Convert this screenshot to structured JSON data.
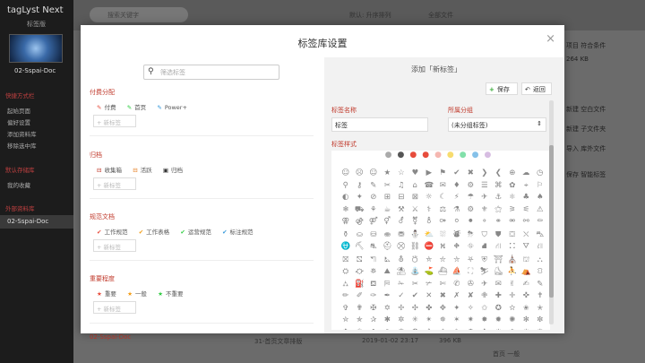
{
  "app": {
    "title": "tagLyst Next",
    "subtitle": "标签版",
    "library_name": "02-Sspai-Doc",
    "sections": [
      {
        "title": "快捷方式栏",
        "items": [
          "起始页面",
          "偏好设置",
          "添加资料库",
          "移除选中库"
        ]
      },
      {
        "title": "默认存储库",
        "items": [
          "我的收藏"
        ]
      },
      {
        "title": "外部资料库",
        "items": [
          "02-Sspai-Doc"
        ]
      }
    ],
    "search_placeholder": "搜索关键字",
    "sort_label": "默认: 升序排列",
    "filter_label": "全部文件",
    "right_info": [
      "项目 符合条件",
      "264 KB",
      "新建 空白文件",
      "新建 子文件夹",
      "导入 库外文件",
      "保存 智能标签"
    ],
    "bottom_row": {
      "name": "31-首页文章排版",
      "date": "2019-01-02 23:17",
      "size": "396 KB",
      "tags": "首页 一般"
    },
    "lib_bottom": "02-Sspai-Doc"
  },
  "dialog": {
    "title": "标签库设置",
    "close": "×",
    "filter_placeholder": "筛选标签",
    "groups": [
      {
        "name": "付费分配",
        "tags": [
          {
            "label": "付费",
            "color": "#e74c3c",
            "icon": "feather-icon"
          },
          {
            "label": "首页",
            "color": "#2ecc40",
            "icon": "feather-icon"
          },
          {
            "label": "Power+",
            "color": "#3498db",
            "icon": "feather-icon"
          }
        ]
      },
      {
        "name": "归档",
        "tags": [
          {
            "label": "收集箱",
            "color": "#c0392b",
            "icon": "inbox-icon"
          },
          {
            "label": "活跃",
            "color": "#e67e22",
            "icon": "inbox-icon"
          },
          {
            "label": "归档",
            "color": "#333333",
            "icon": "archive-icon"
          }
        ]
      },
      {
        "name": "规范文档",
        "tags": [
          {
            "label": "工作规范",
            "color": "#e74c3c",
            "icon": "check-icon"
          },
          {
            "label": "工作表格",
            "color": "#f39c12",
            "icon": "check-icon"
          },
          {
            "label": "运营规范",
            "color": "#2ecc40",
            "icon": "check-icon"
          },
          {
            "label": "标注规范",
            "color": "#3498db",
            "icon": "check-icon"
          }
        ]
      },
      {
        "name": "重要程度",
        "tags": [
          {
            "label": "重要",
            "color": "#e74c3c",
            "icon": "star-icon"
          },
          {
            "label": "一般",
            "color": "#f39c12",
            "icon": "star-icon"
          },
          {
            "label": "不重要",
            "color": "#2ecc40",
            "icon": "star-icon"
          }
        ]
      }
    ],
    "new_tag_label": "+ 新标签",
    "panel_title": "添加「新标签」",
    "save_label": "保存",
    "back_label": "返回",
    "name_label": "标签名称",
    "name_value": "标签",
    "group_label": "所属分组",
    "group_value": "(未分组标签)",
    "style_label": "标签样式",
    "style_colors": [
      "#aaaaaa",
      "#555555",
      "#e74c3c",
      "#e74c3c",
      "#f5b7b1",
      "#f7dc6f",
      "#82e0aa",
      "#85c1e9",
      "#d7bde2"
    ],
    "icons": [
      "☺",
      "☹",
      "☺",
      "★",
      "☆",
      "♥",
      "▶",
      "⚑",
      "✔",
      "✖",
      "❯",
      "❮",
      "⊕",
      "☁",
      "◷",
      "⚲",
      "⚷",
      "✎",
      "✂",
      "♫",
      "⌂",
      "☎",
      "✉",
      "♦",
      "⚙",
      "☰",
      "⌘",
      "✿",
      "⌖",
      "⚐",
      "◐",
      "✦",
      "⊘",
      "⊞",
      "⊟",
      "⊠",
      "☼",
      "☾",
      "⚡",
      "☂",
      "✈",
      "⚓",
      "⚛",
      "♣",
      "♠",
      "❄",
      "⛟",
      "⚘",
      "☕",
      "⚒",
      "⚔",
      "⚕",
      "⚖",
      "⚗",
      "⚙",
      "⚜",
      "⚝",
      "⚞",
      "⚟",
      "⚠",
      "⚢",
      "⚣",
      "⚤",
      "⚥",
      "⚦",
      "⚧",
      "⚨",
      "⚩",
      "⚪",
      "⚫",
      "⚬",
      "⚭",
      "⚮",
      "⚯",
      "⚰",
      "⚱",
      "⛀",
      "⛁",
      "⛂",
      "⛃",
      "⛄",
      "⛅",
      "⛆",
      "⛇",
      "⛈",
      "⛉",
      "⛊",
      "⛋",
      "⛌",
      "⛍",
      "⛎",
      "⛏",
      "⛐",
      "⛑",
      "⛒",
      "⛓",
      "⛔",
      "⛕",
      "⛖",
      "⛗",
      "⛘",
      "⛙",
      "⛚",
      "⛛",
      "⛜",
      "⛝",
      "⛞",
      "⛠",
      "⛡",
      "⛢",
      "⛣",
      "⛤",
      "⛥",
      "⛦",
      "⛧",
      "⛨",
      "⛩",
      "⛪",
      "⛫",
      "⛬",
      "⛭",
      "⛮",
      "⛯",
      "⛰",
      "⛱",
      "⛲",
      "⛳",
      "⛴",
      "⛵",
      "⛶",
      "⛷",
      "⛸",
      "⛹",
      "⛺",
      "⛻",
      "⛼",
      "⛽",
      "⛾",
      "⛿",
      "✁",
      "✂",
      "✃",
      "✄",
      "✆",
      "✇",
      "✈",
      "✉",
      "✌",
      "✍",
      "✎",
      "✏",
      "✐",
      "✑",
      "✒",
      "✓",
      "✔",
      "✕",
      "✖",
      "✗",
      "✘",
      "✙",
      "✚",
      "✛",
      "✜",
      "✝",
      "✞",
      "✟",
      "✠",
      "✡",
      "✢",
      "✣",
      "✤",
      "✥",
      "✦",
      "✧",
      "✩",
      "✪",
      "✫",
      "✬",
      "✭",
      "✮",
      "✯",
      "✰",
      "✱",
      "✲",
      "✳",
      "✴",
      "✵",
      "✶",
      "✷",
      "✸",
      "✹",
      "✺",
      "✻",
      "✼",
      "✽",
      "✾",
      "✿",
      "❀",
      "❁",
      "❂",
      "❃",
      "❄",
      "❅",
      "❆",
      "❇",
      "❈",
      "❉",
      "❊",
      "❋",
      "❍",
      "❏",
      "❐",
      "❑",
      "❒",
      "❖",
      "❘",
      "❙",
      "❚",
      "❛",
      "❜",
      "❝",
      "❞",
      "❡",
      "❢",
      "❣",
      "❤",
      "❥",
      "❦",
      "❧"
    ]
  }
}
